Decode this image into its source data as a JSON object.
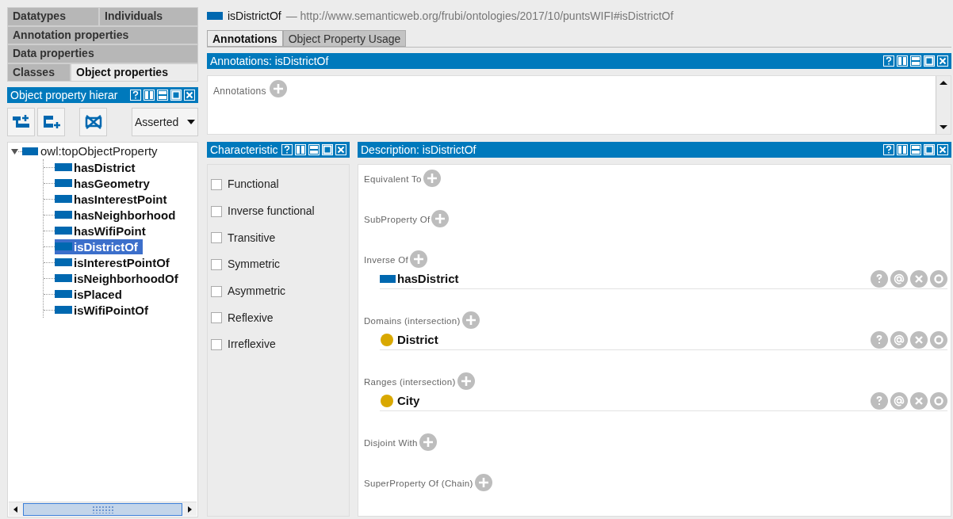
{
  "left": {
    "tab_rows": [
      [
        {
          "label": "Datatypes",
          "selected": false
        },
        {
          "label": "Individuals",
          "selected": false
        }
      ],
      [
        {
          "label": "Annotation properties",
          "selected": false
        }
      ],
      [
        {
          "label": "Data properties",
          "selected": false
        }
      ],
      [
        {
          "label": "Classes",
          "selected": false
        },
        {
          "label": "Object properties",
          "selected": true
        }
      ]
    ],
    "hierarchy_title": "Object property hierar",
    "view_mode": "Asserted",
    "tree": {
      "label": "owl:topObjectProperty",
      "expanded": true,
      "selected": false,
      "children": [
        {
          "label": "hasDistrict",
          "selected": false
        },
        {
          "label": "hasGeometry",
          "selected": false
        },
        {
          "label": "hasInterestPoint",
          "selected": false
        },
        {
          "label": "hasNeighborhood",
          "selected": false
        },
        {
          "label": "hasWifiPoint",
          "selected": false
        },
        {
          "label": "isDistrictOf",
          "selected": true
        },
        {
          "label": "isInterestPointOf",
          "selected": false
        },
        {
          "label": "isNeighborhoodOf",
          "selected": false
        },
        {
          "label": "isPlaced",
          "selected": false
        },
        {
          "label": "isWifiPointOf",
          "selected": false
        }
      ]
    }
  },
  "entity": {
    "name": "isDistrictOf",
    "iri": "— http://www.semanticweb.org/frubi/ontologies/2017/10/puntsWIFI#isDistrictOf"
  },
  "tabs": [
    {
      "label": "Annotations",
      "selected": true
    },
    {
      "label": "Object Property Usage",
      "selected": false
    }
  ],
  "annotations": {
    "title": "Annotations: isDistrictOf",
    "label": "Annotations"
  },
  "characteristics": {
    "title": "Characteristic",
    "items": [
      {
        "label": "Functional",
        "checked": false
      },
      {
        "label": "Inverse functional",
        "checked": false
      },
      {
        "label": "Transitive",
        "checked": false
      },
      {
        "label": "Symmetric",
        "checked": false
      },
      {
        "label": "Asymmetric",
        "checked": false
      },
      {
        "label": "Reflexive",
        "checked": false
      },
      {
        "label": "Irreflexive",
        "checked": false
      }
    ]
  },
  "description": {
    "title": "Description: isDistrictOf",
    "sections": [
      {
        "label": "Equivalent To"
      },
      {
        "label": "SubProperty Of"
      },
      {
        "label": "Inverse Of",
        "items": [
          {
            "kind": "property",
            "label": "hasDistrict"
          }
        ]
      },
      {
        "label": "Domains (intersection)",
        "items": [
          {
            "kind": "class",
            "label": "District"
          }
        ]
      },
      {
        "label": "Ranges (intersection)",
        "items": [
          {
            "kind": "class",
            "label": "City"
          }
        ]
      },
      {
        "label": "Disjoint With"
      },
      {
        "label": "SuperProperty Of (Chain)"
      }
    ]
  }
}
